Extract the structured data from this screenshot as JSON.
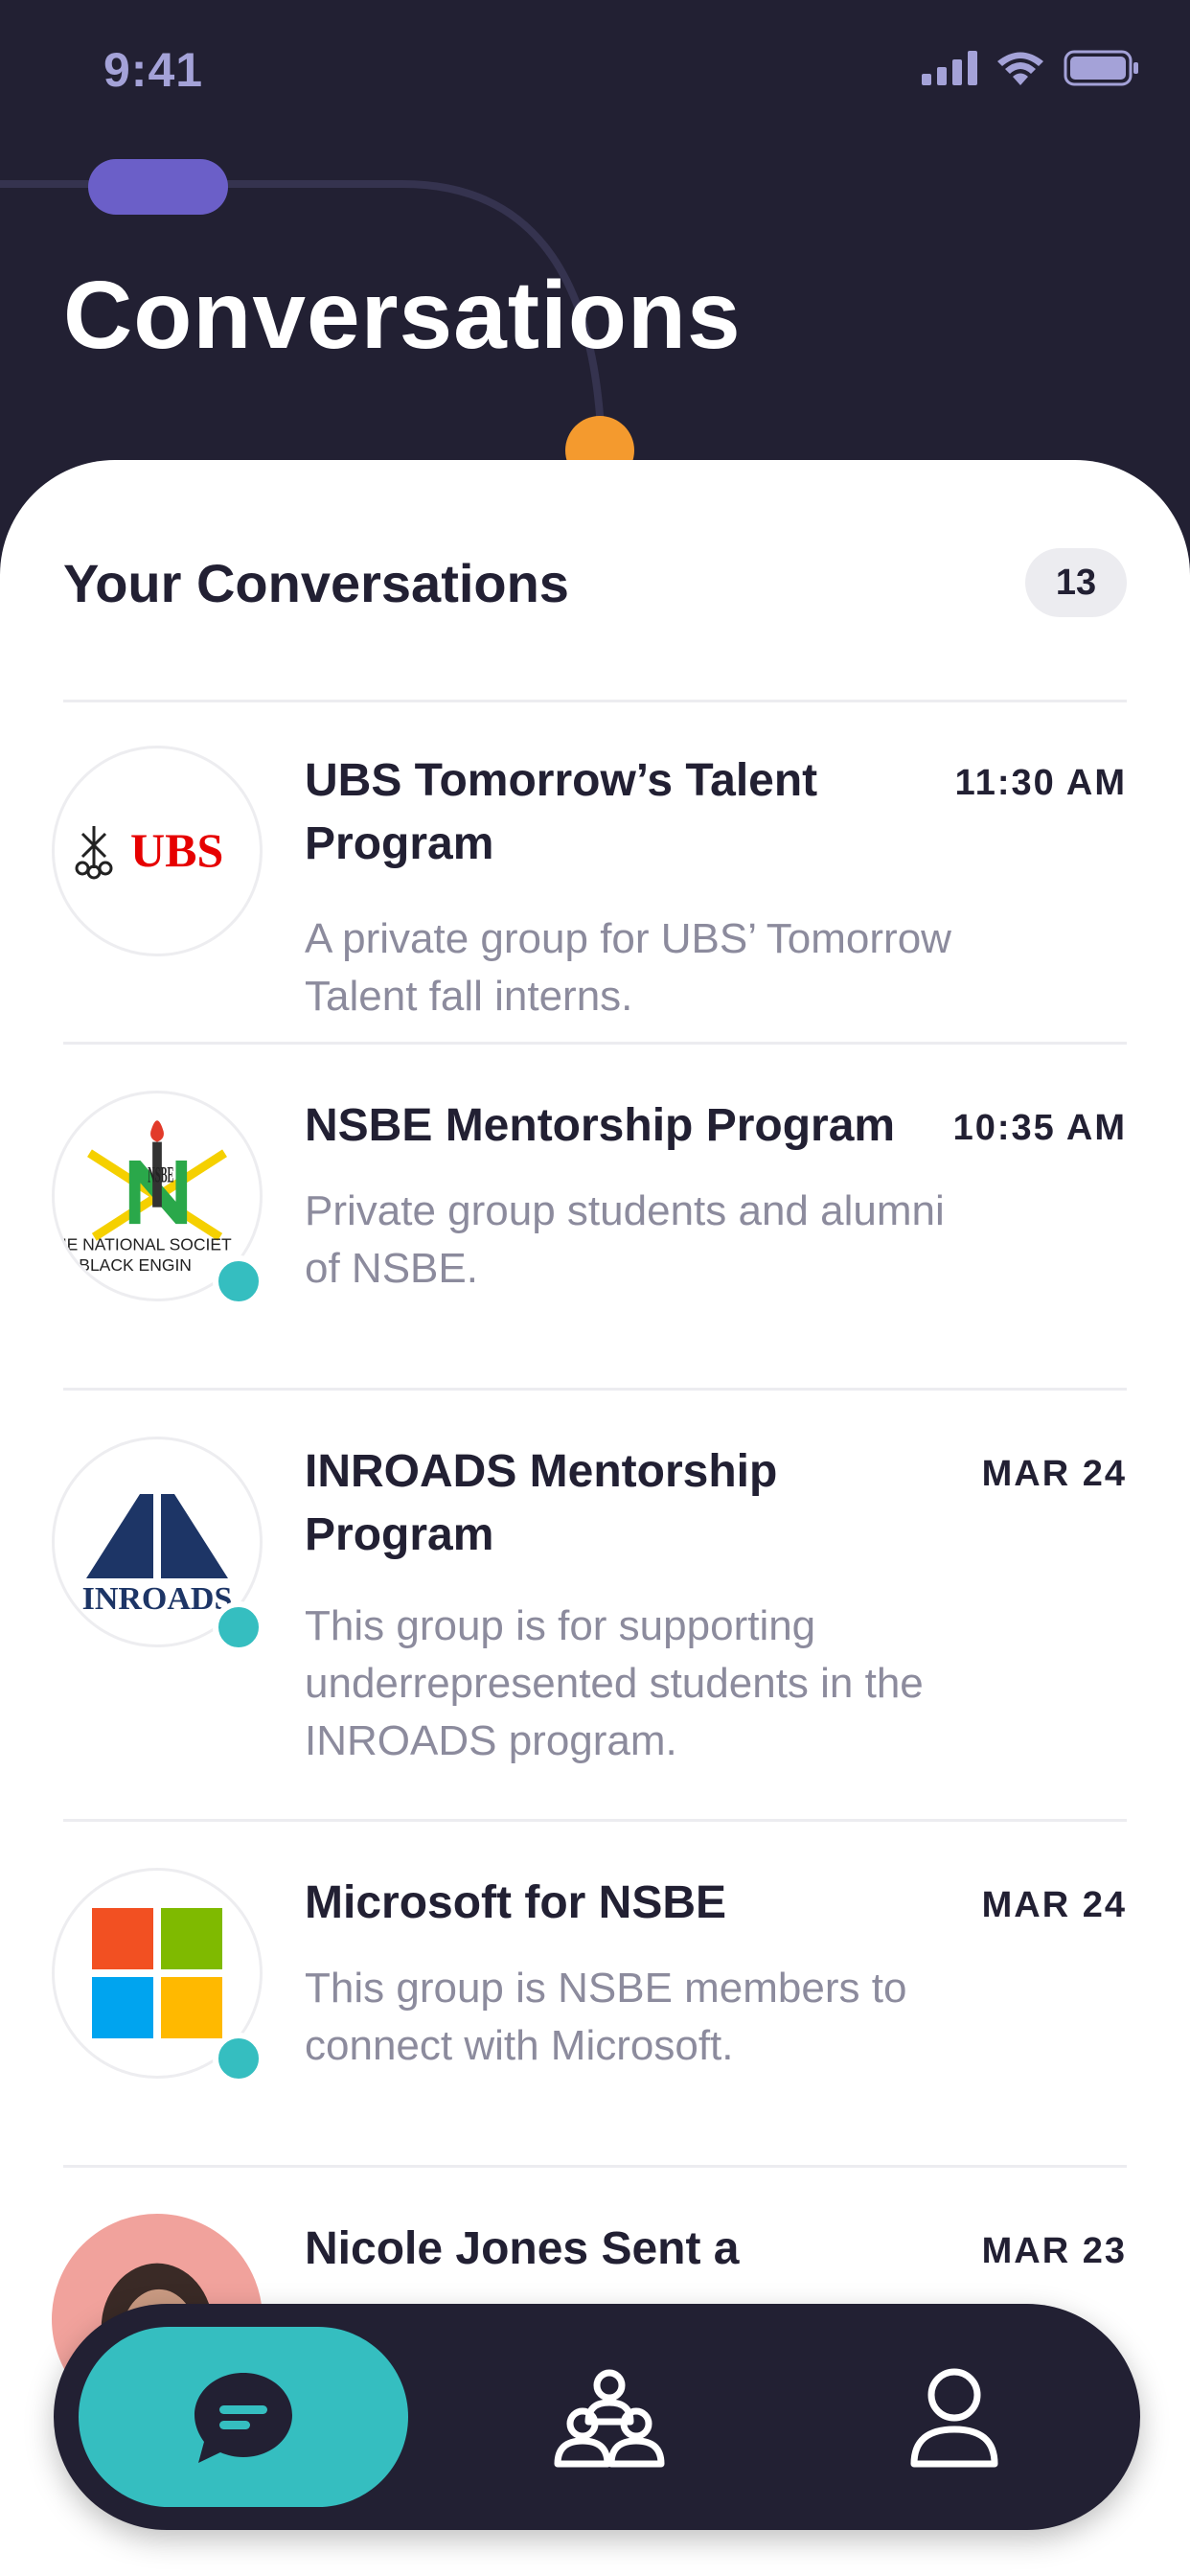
{
  "status_bar": {
    "time": "9:41",
    "icons": [
      "cellular-signal-icon",
      "wifi-icon",
      "battery-icon"
    ]
  },
  "header": {
    "title": "Conversations"
  },
  "list": {
    "title": "Your Conversations",
    "count": "13",
    "items": [
      {
        "logo": "ubs-logo",
        "logo_text": "UBS",
        "title": "UBS Tomorrow’s Talent Program",
        "time": "11:30 AM",
        "description": "A private group for UBS’ Tomorrow Talent fall interns.",
        "online": false
      },
      {
        "logo": "nsbe-logo",
        "logo_text": "NSBE",
        "logo_caption_1": "HE NATIONAL SOCIET",
        "logo_caption_2": "F BLACK ENGIN",
        "title": "NSBE Mentorship Program",
        "time": "10:35 AM",
        "description": "Private group students and alumni of NSBE.",
        "online": true
      },
      {
        "logo": "inroads-logo",
        "logo_text": "INROADS",
        "title": "INROADS Mentorship Program",
        "time": "MAR 24",
        "description": "This group is for supporting underrepresented students in the INROADS program.",
        "online": true
      },
      {
        "logo": "microsoft-logo",
        "title": "Microsoft for NSBE",
        "time": "MAR 24",
        "description": "This group is NSBE members to connect with Microsoft.",
        "online": true
      },
      {
        "logo": "user-photo",
        "title": "Nicole Jones Sent a",
        "time": "MAR 23",
        "description": "",
        "online": false
      }
    ]
  },
  "nav": {
    "items": [
      {
        "name": "chat",
        "icon": "chat-bubble-icon",
        "active": true
      },
      {
        "name": "groups",
        "icon": "group-icon",
        "active": false
      },
      {
        "name": "profile",
        "icon": "profile-icon",
        "active": false
      }
    ]
  },
  "colors": {
    "dark": "#222033",
    "accent": "#35bec0",
    "purple": "#6b5fc8",
    "orange": "#f49a2e",
    "muted_text": "#8c8b9d"
  }
}
